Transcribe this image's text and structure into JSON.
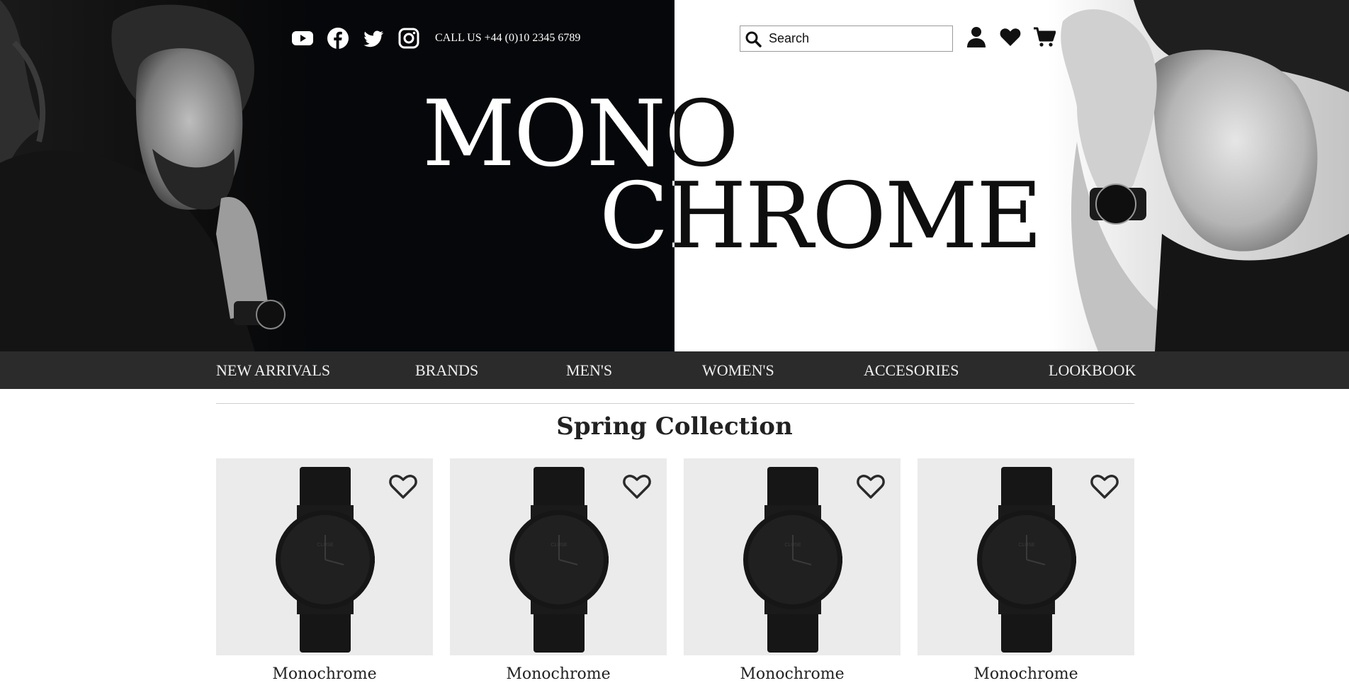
{
  "header": {
    "call_text": "CALL US +44 (0)10 2345 6789",
    "search": {
      "placeholder": "Search",
      "value": ""
    },
    "social": [
      "youtube-icon",
      "facebook-icon",
      "twitter-icon",
      "instagram-icon"
    ],
    "account_icons": [
      "user-icon",
      "heart-icon",
      "cart-icon"
    ]
  },
  "hero": {
    "logo_line_1": "MONO",
    "logo_line_2": "CHROME"
  },
  "nav": {
    "items": [
      {
        "label": "NEW ARRIVALS"
      },
      {
        "label": "BRANDS"
      },
      {
        "label": "MEN'S"
      },
      {
        "label": "WOMEN'S"
      },
      {
        "label": "ACCESORIES"
      },
      {
        "label": "LOOKBOOK"
      }
    ]
  },
  "section": {
    "title": "Spring Collection"
  },
  "products": [
    {
      "name": "Monochrome",
      "brand_mark": "CLUSE"
    },
    {
      "name": "Monochrome",
      "brand_mark": "CLUSE"
    },
    {
      "name": "Monochrome",
      "brand_mark": "CLUSE"
    },
    {
      "name": "Monochrome",
      "brand_mark": "CLUSE"
    }
  ],
  "colors": {
    "hero_dark": "#05070a",
    "hero_light": "#ffffff",
    "nav_bg": "#2b2b2b",
    "nav_text": "#f0f0f0",
    "card_bg": "#ebebeb"
  }
}
